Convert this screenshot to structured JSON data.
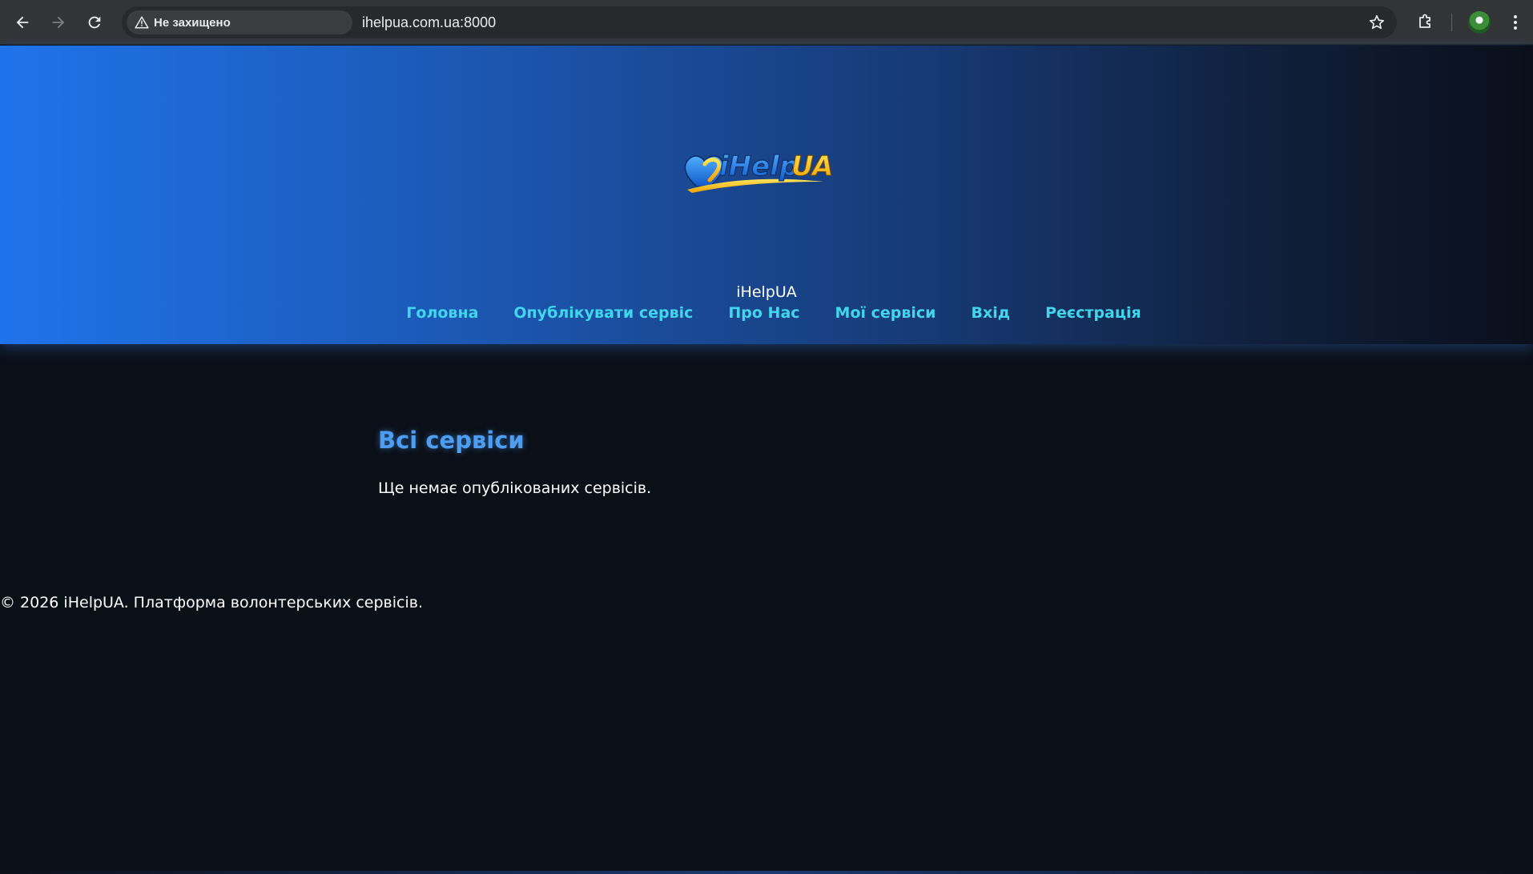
{
  "browser": {
    "security_label": "Не захищено",
    "url": "ihelpua.com.ua:8000",
    "icons": {
      "back": "arrow-left-icon",
      "forward": "arrow-right-icon",
      "reload": "reload-icon",
      "warning": "warning-triangle-icon",
      "bookmark": "star-icon",
      "extensions": "puzzle-icon",
      "profile": "avatar",
      "menu": "kebab-menu-icon"
    }
  },
  "header": {
    "logo_text_main": "iHelp",
    "logo_text_accent": "UA",
    "site_name": "iHelpUA",
    "nav": [
      {
        "label": "Головна"
      },
      {
        "label": "Опублікувати сервіс"
      },
      {
        "label": "Про Нас"
      },
      {
        "label": "Мої сервіси"
      },
      {
        "label": "Вхід"
      },
      {
        "label": "Реєстрація"
      }
    ]
  },
  "main": {
    "title": "Всі сервіси",
    "empty_message": "Ще немає опублікованих сервісів."
  },
  "footer": {
    "text": "© 2026 iHelpUA. Платформа волонтерських сервісів."
  },
  "colors": {
    "page_bg": "#0b0f18",
    "nav_link": "#41d6ec",
    "title": "#4d9df3",
    "header_gradient_start": "#1f73ea",
    "header_gradient_end": "#0a0f1a"
  }
}
